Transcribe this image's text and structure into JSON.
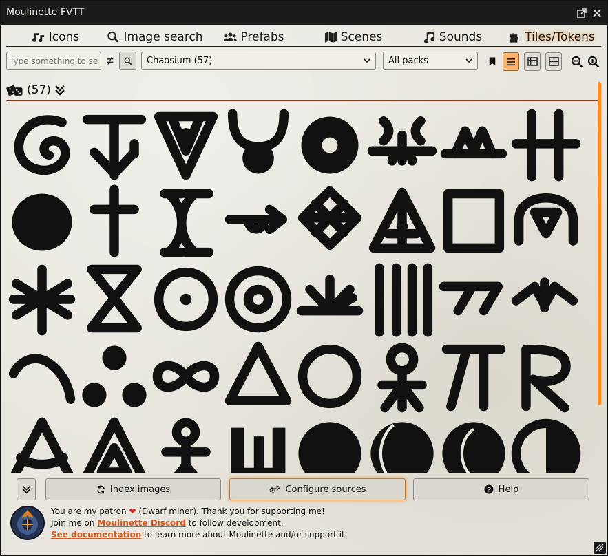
{
  "window": {
    "title": "Moulinette FVTT"
  },
  "tabs": [
    {
      "id": "icons",
      "label": "Icons",
      "icon": "music-note-icon"
    },
    {
      "id": "image-search",
      "label": "Image search",
      "icon": "magnifier-icon"
    },
    {
      "id": "prefabs",
      "label": "Prefabs",
      "icon": "users-icon"
    },
    {
      "id": "scenes",
      "label": "Scenes",
      "icon": "map-icon"
    },
    {
      "id": "sounds",
      "label": "Sounds",
      "icon": "music-icon"
    },
    {
      "id": "tiles",
      "label": "Tiles/Tokens",
      "icon": "puzzle-icon",
      "active": true
    }
  ],
  "toolbar": {
    "search_placeholder": "Type something to search",
    "search_value": "",
    "not_equal": "≠",
    "source_selected": "Chaosium (57)",
    "packs_selected": "All packs"
  },
  "results": {
    "count_label": "(57)"
  },
  "buttons": {
    "index": "Index images",
    "configure": "Configure sources",
    "help": "Help"
  },
  "patron": {
    "line1_a": "You are my patron",
    "line1_b": "(Dwarf miner). Thank you for supporting me!",
    "line2_a": "Join me on",
    "line2_link": "Moulinette Discord",
    "line2_b": "to follow development.",
    "line3_link": "See documentation",
    "line3_b": "to learn more about Moulinette and/or support it."
  },
  "colors": {
    "accent": "#ff8a1e",
    "link": "#d9571b",
    "heart": "#d91c1c"
  },
  "symbols": [
    "spiral",
    "arrow-cross",
    "triangle-v",
    "horned-circle",
    "ring-disk",
    "ship-horns",
    "m-line",
    "double-cross",
    "round-blob",
    "cross",
    "bracket-x",
    "hook-arrow",
    "woven-diamond",
    "star-triangle",
    "square",
    "omega-triangle",
    "asterisk",
    "hourglass",
    "circle-dot",
    "concentric",
    "fan",
    "bars",
    "seven-seven",
    "arrow-rune",
    "bow",
    "three-dots",
    "infinity",
    "triangle",
    "ring",
    "ankh-circle",
    "pi-shape",
    "r-shape",
    "circle-triangle",
    "nested-triangle",
    "stick-man",
    "crenel",
    "disk",
    "crescent-left",
    "crescent-right",
    "half-disk"
  ]
}
